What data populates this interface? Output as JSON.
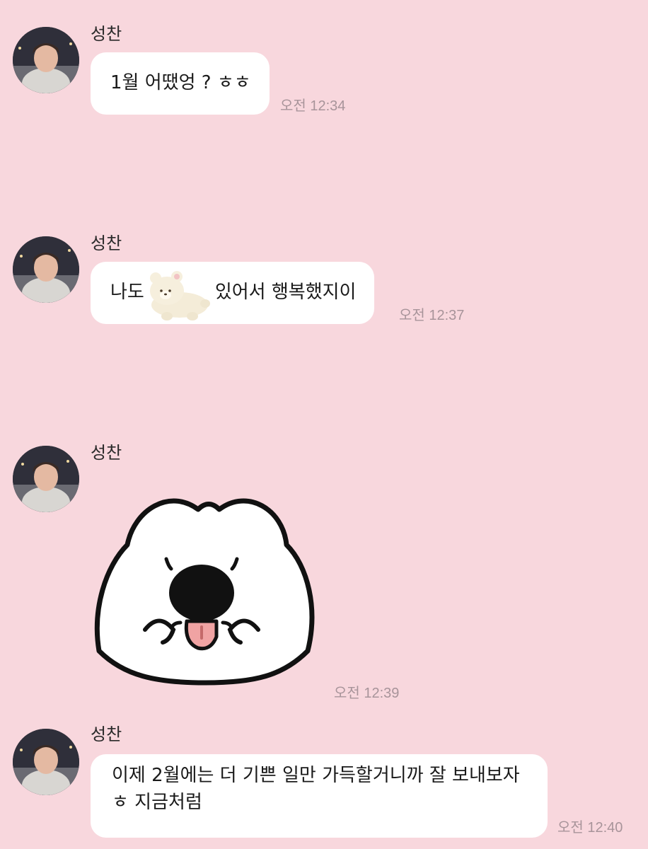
{
  "messages": [
    {
      "sender": "성찬",
      "text": "1월 어땠엉 ? ㅎㅎ",
      "time": "오전 12:34"
    },
    {
      "sender": "성찬",
      "text_before": "나도",
      "sticker": "bear-plush-icon",
      "text_after": "있어서 행복했지이",
      "time": "오전 12:37"
    },
    {
      "sender": "성찬",
      "sticker": "white-puppy-tongue-sticker",
      "time": "오전 12:39"
    },
    {
      "sender": "성찬",
      "lines": [
        "이제 2월에는 더 기쁜 일만 가득할거니까 잘 보내보자",
        "ㅎ 지금처럼"
      ],
      "time": "오전 12:40"
    }
  ],
  "colors": {
    "background": "#f8d7dd",
    "bubble": "#ffffff",
    "time": "#a8949a"
  }
}
